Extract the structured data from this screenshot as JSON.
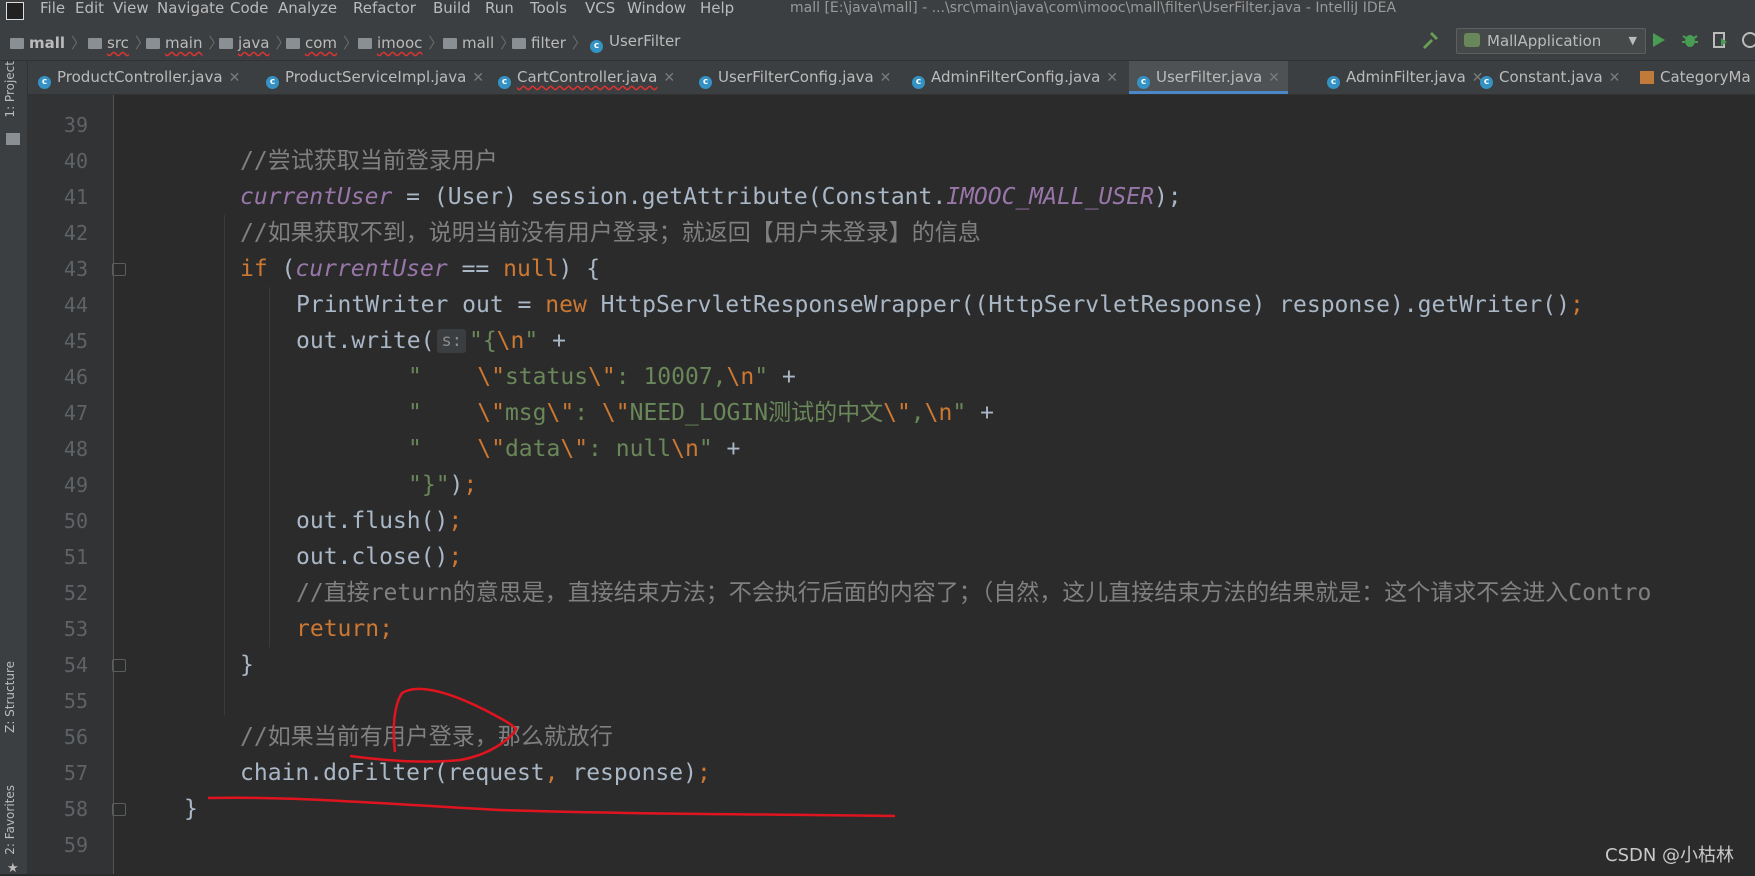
{
  "menu": {
    "items": [
      "File",
      "Edit",
      "View",
      "Navigate",
      "Code",
      "Analyze",
      "Refactor",
      "Build",
      "Run",
      "Tools",
      "VCS",
      "Window",
      "Help"
    ],
    "window_title": "mall [E:\\java\\mall] - ...\\src\\main\\java\\com\\imooc\\mall\\filter\\UserFilter.java - IntelliJ IDEA"
  },
  "breadcrumb": [
    "mall",
    "src",
    "main",
    "java",
    "com",
    "imooc",
    "mall",
    "filter",
    "UserFilter"
  ],
  "run_config": {
    "label": "MallApplication"
  },
  "tabs": [
    {
      "label": "ProductController.java"
    },
    {
      "label": "ProductServiceImpl.java"
    },
    {
      "label": "CartController.java"
    },
    {
      "label": "UserFilterConfig.java"
    },
    {
      "label": "AdminFilterConfig.java"
    },
    {
      "label": "UserFilter.java"
    },
    {
      "label": "AdminFilter.java"
    },
    {
      "label": "Constant.java"
    },
    {
      "label": "CategoryMa"
    }
  ],
  "tool_windows": {
    "project": "1: Project",
    "structure": "Z: Structure",
    "favorites": "2: Favorites"
  },
  "line_numbers": [
    "39",
    "40",
    "41",
    "42",
    "43",
    "44",
    "45",
    "46",
    "47",
    "48",
    "49",
    "50",
    "51",
    "52",
    "53",
    "54",
    "55",
    "56",
    "57",
    "58",
    "59"
  ],
  "code": {
    "l40": "//尝试获取当前登录用户",
    "l41_a": "currentUser",
    "l41_b": " = (User) session.getAttribute(Constant.",
    "l41_c": "IMOOC_MALL_USER",
    "l41_d": ");",
    "l42": "//如果获取不到，说明当前没有用户登录；就返回【用户未登录】的信息",
    "l43_kw": "if",
    "l43_a": " (",
    "l43_b": "currentUser",
    "l43_c": " == ",
    "l43_d": "null",
    "l43_e": ") {",
    "l44_a": "PrintWriter out = ",
    "l44_b": "new",
    "l44_c": " HttpServletResponseWrapper((HttpServletResponse) response).getWriter()",
    "l44_d": ";",
    "l45_a": "out.write(",
    "l45_hint": "s:",
    "l45_b": "\"{",
    "l45_esc": "\\n",
    "l45_c": "\"",
    "l45_d": " +",
    "l46_a": "\"    ",
    "l46_e1": "\\\"",
    "l46_b": "status",
    "l46_e2": "\\\"",
    "l46_c": ": 10007,",
    "l46_e3": "\\n",
    "l46_d": "\"",
    "l46_plus": " +",
    "l47_a": "\"    ",
    "l47_e1": "\\\"",
    "l47_b": "msg",
    "l47_e2": "\\\"",
    "l47_c": ": ",
    "l47_e3": "\\\"",
    "l47_d": "NEED_LOGIN测试的中文",
    "l47_e4": "\\\"",
    "l47_f": ",",
    "l47_e5": "\\n",
    "l47_g": "\"",
    "l47_plus": " +",
    "l48_a": "\"    ",
    "l48_e1": "\\\"",
    "l48_b": "data",
    "l48_e2": "\\\"",
    "l48_c": ": null",
    "l48_e3": "\\n",
    "l48_d": "\"",
    "l48_plus": " +",
    "l49_a": "\"}\"",
    "l49_b": ")",
    "l49_c": ";",
    "l50_a": "out.flush()",
    "l50_b": ";",
    "l51_a": "out.close()",
    "l51_b": ";",
    "l52": "//直接return的意思是，直接结束方法；不会执行后面的内容了；（自然，这儿直接结束方法的结果就是：这个请求不会进入Contro",
    "l53_kw": "return",
    "l53_b": ";",
    "l54": "}",
    "l56": "//如果当前有用户登录，那么就放行",
    "l57_a": "chain.doFilter(request",
    "l57_b": ",",
    "l57_c": " response)",
    "l57_d": ";",
    "l58": "}"
  },
  "watermark": "CSDN @小枯林",
  "colors": {
    "editor_bg": "#2b2b2b",
    "comment": "#808080",
    "keyword": "#cc7832",
    "field": "#9876aa",
    "string": "#6a8759",
    "annotation_pen": "#e0141e"
  }
}
